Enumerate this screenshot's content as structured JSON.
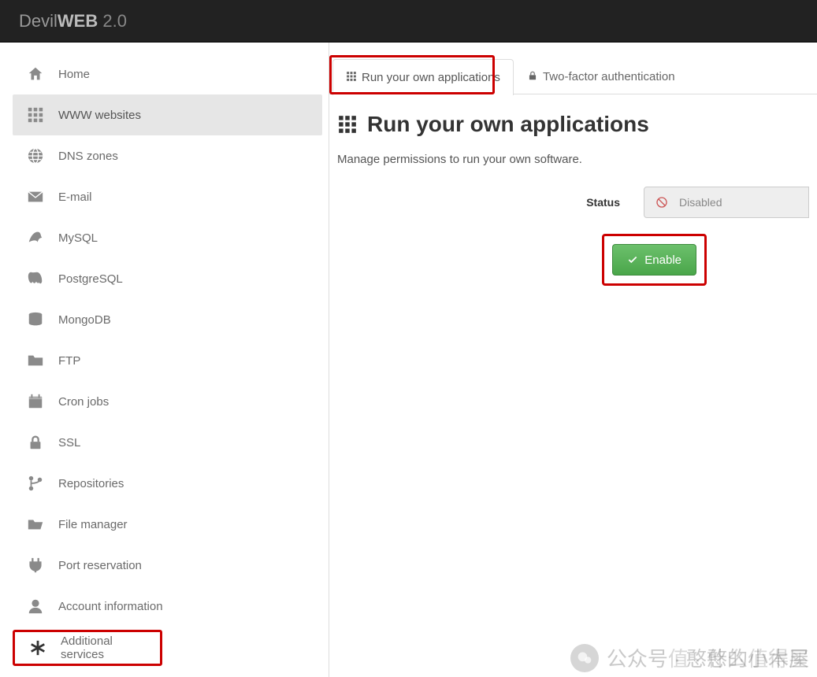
{
  "brand": {
    "name1": "Devil",
    "name2": "WEB",
    "version": " 2.0"
  },
  "sidebar": {
    "items": [
      {
        "label": "Home",
        "icon": "home"
      },
      {
        "label": "WWW websites",
        "icon": "grid",
        "active": true
      },
      {
        "label": "DNS zones",
        "icon": "globe"
      },
      {
        "label": "E-mail",
        "icon": "envelope"
      },
      {
        "label": "MySQL",
        "icon": "mysql"
      },
      {
        "label": "PostgreSQL",
        "icon": "postgresql"
      },
      {
        "label": "MongoDB",
        "icon": "database"
      },
      {
        "label": "FTP",
        "icon": "folder"
      },
      {
        "label": "Cron jobs",
        "icon": "calendar"
      },
      {
        "label": "SSL",
        "icon": "lock"
      },
      {
        "label": "Repositories",
        "icon": "branch"
      },
      {
        "label": "File manager",
        "icon": "folder-open"
      },
      {
        "label": "Port reservation",
        "icon": "plug"
      },
      {
        "label": "Account information",
        "icon": "user"
      },
      {
        "label": "Additional services",
        "icon": "asterisk",
        "highlight": true
      }
    ]
  },
  "tabs": [
    {
      "label": "Run your own applications",
      "icon": "grid",
      "active": true,
      "highlight": true
    },
    {
      "label": "Two-factor authentication",
      "icon": "lock"
    }
  ],
  "page": {
    "title": "Run your own applications",
    "subtitle": "Manage permissions to run your own software.",
    "status_label": "Status",
    "status_value": "Disabled",
    "enable_label": "Enable"
  },
  "watermark": {
    "text1": "公众号 · 憨憨的小木屋",
    "text2": "值 · 什么值得买"
  }
}
